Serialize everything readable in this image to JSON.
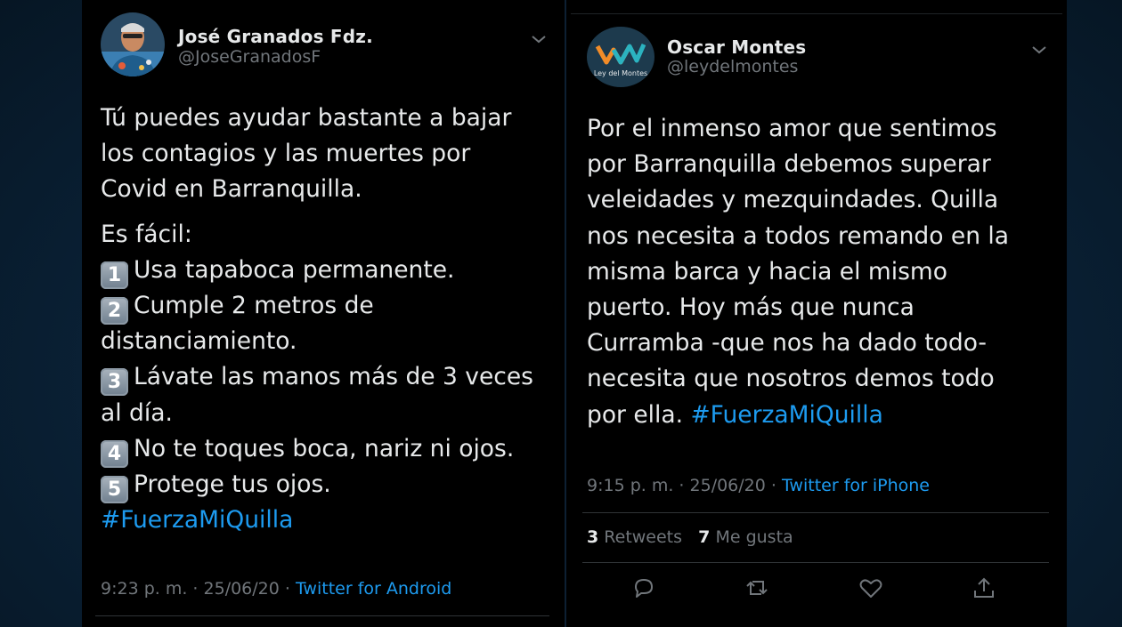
{
  "left_tweet": {
    "author_name": "José Granados Fdz.",
    "author_handle": "@JoseGranadosF",
    "lines": [
      "Tú puedes ayudar bastante a bajar",
      "los contagios y las muertes por",
      "Covid en Barranquilla."
    ],
    "list_intro": "Es fácil:",
    "items": [
      {
        "key": "1",
        "text": "Usa tapaboca permanente."
      },
      {
        "key": "2",
        "text": "Cumple 2 metros de",
        "cont": "distanciamiento."
      },
      {
        "key": "3",
        "text": "Lávate las manos más de 3 veces",
        "cont": "al día."
      },
      {
        "key": "4",
        "text": "No te toques boca, nariz ni ojos."
      },
      {
        "key": "5",
        "text": "Protege tus ojos."
      }
    ],
    "hashtag": "#FuerzaMiQuilla",
    "timestamp": "9:23 p. m. · 25/06/20 · ",
    "source": "Twitter for Android"
  },
  "right_tweet": {
    "author_name": "Oscar Montes",
    "author_handle": "@leydelmontes",
    "avatar_text": "Ley del Montes",
    "lines": [
      "Por el inmenso amor que sentimos",
      "por Barranquilla debemos superar",
      "veleidades y mezquindades. Quilla",
      "nos necesita a todos remando en la",
      "misma barca y hacia el mismo",
      "puerto. Hoy más que nunca",
      "Curramba -que nos ha dado todo-",
      "necesita que nosotros demos todo"
    ],
    "last_line_prefix": "por ella. ",
    "hashtag": "#FuerzaMiQuilla",
    "timestamp": "9:15 p. m. · 25/06/20 · ",
    "source": "Twitter for iPhone",
    "retweets_count": "3",
    "retweets_label": "Retweets",
    "likes_count": "7",
    "likes_label": "Me gusta"
  },
  "colors": {
    "link": "#1d9bf0",
    "muted": "#71767b",
    "text": "#e7e9ea",
    "background": "#000000"
  },
  "icons": [
    "chevron-down-icon",
    "reply-icon",
    "retweet-icon",
    "like-icon",
    "share-icon"
  ]
}
